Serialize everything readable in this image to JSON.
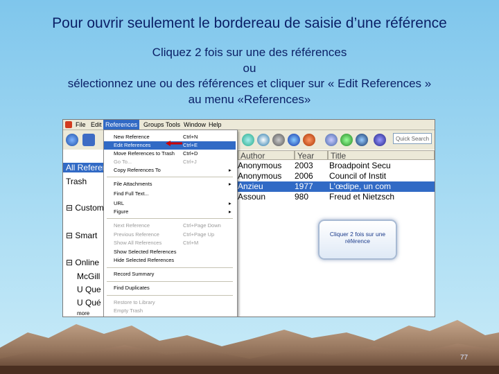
{
  "slide": {
    "title": "Pour ouvrir seulement le bordereau de saisie d’une référence",
    "line1": "Cliquez 2 fois sur une des références",
    "line2": "ou",
    "line3": "sélectionnez une ou des références et cliquer sur  « Edit References »",
    "line4": "au menu  «References»",
    "page_number": "77"
  },
  "app": {
    "menubar": [
      "File",
      "Edit",
      "References",
      "Groups",
      "Tools",
      "Window",
      "Help"
    ],
    "search_placeholder": "Quick Search",
    "left_pane": [
      "All References",
      "Trash",
      "Custom",
      "Smart",
      "Online",
      "McGill",
      "U Que",
      "U Qué",
      "more"
    ],
    "table_headers": [
      "Author",
      "Year",
      "Title"
    ],
    "rows": [
      {
        "author": "Anonymous",
        "year": "2003",
        "title": "Broadpoint Secu"
      },
      {
        "author": "Anonymous",
        "year": "2006",
        "title": "Council of Instit"
      },
      {
        "author": "Anzieu",
        "year": "1977",
        "title": "L'œdipe, un com"
      },
      {
        "author": "Assoun",
        "year": "980",
        "title": "Freud et Nietzsch"
      }
    ],
    "menu_items": [
      {
        "label": "New Reference",
        "shortcut": "Ctrl+N",
        "state": "normal"
      },
      {
        "label": "Edit References",
        "shortcut": "Ctrl+E",
        "state": "highlight"
      },
      {
        "label": "Move References to Trash",
        "shortcut": "Ctrl+D",
        "state": "normal"
      },
      {
        "label": "Go To...",
        "shortcut": "Ctrl+J",
        "state": "disabled"
      },
      {
        "label": "Copy References To",
        "shortcut": "",
        "state": "normal",
        "submenu": true
      },
      {
        "label": "File Attachments",
        "shortcut": "",
        "state": "normal",
        "submenu": true
      },
      {
        "label": "Find Full Text...",
        "shortcut": "",
        "state": "normal"
      },
      {
        "label": "URL",
        "shortcut": "",
        "state": "normal",
        "submenu": true
      },
      {
        "label": "Figure",
        "shortcut": "",
        "state": "normal",
        "submenu": true
      },
      {
        "label": "Next Reference",
        "shortcut": "Ctrl+Page Down",
        "state": "disabled"
      },
      {
        "label": "Previous Reference",
        "shortcut": "Ctrl+Page Up",
        "state": "disabled"
      },
      {
        "label": "Show All References",
        "shortcut": "Ctrl+M",
        "state": "disabled"
      },
      {
        "label": "Show Selected References",
        "shortcut": "",
        "state": "normal"
      },
      {
        "label": "Hide Selected References",
        "shortcut": "",
        "state": "normal"
      },
      {
        "label": "Record Summary",
        "shortcut": "",
        "state": "normal"
      },
      {
        "label": "Find Duplicates",
        "shortcut": "",
        "state": "normal"
      },
      {
        "label": "Restore to Library",
        "shortcut": "",
        "state": "disabled"
      },
      {
        "label": "Empty Trash",
        "shortcut": "",
        "state": "disabled"
      }
    ],
    "callout": "Cliquer 2 fois sur une référence"
  },
  "colors": {
    "text_dark": "#0a1f66",
    "selection": "#316ac5",
    "menu_arrow": "#cc0000"
  },
  "icons": [
    "app-logo-icon",
    "globe-icon",
    "book-icon",
    "back-arrow-icon",
    "help-icon",
    "word-icon",
    "search-icon"
  ]
}
